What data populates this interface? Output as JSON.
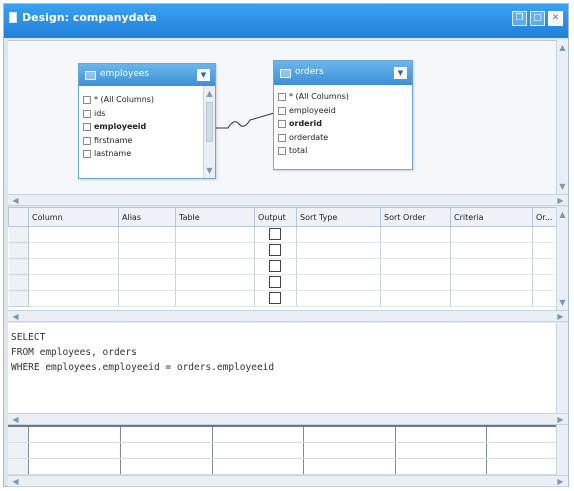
{
  "window": {
    "title": "Design: companydata",
    "icon": "document-icon",
    "buttons": [
      "restore-icon",
      "close-icon"
    ]
  },
  "diagram": {
    "tables": [
      {
        "name": "employees",
        "columns": [
          {
            "label": "* (All Columns)"
          },
          {
            "label": "ids"
          },
          {
            "label": "employeeid"
          },
          {
            "label": "firstname"
          },
          {
            "label": "lastname"
          }
        ]
      },
      {
        "name": "orders",
        "columns": [
          {
            "label": "* (All Columns)"
          },
          {
            "label": "employeeid"
          },
          {
            "label": "orderid"
          },
          {
            "label": "orderdate"
          },
          {
            "label": "total"
          }
        ]
      }
    ]
  },
  "grid": {
    "headers": [
      "Column",
      "Alias",
      "Table",
      "Output",
      "Sort Type",
      "Sort Order",
      "Criteria",
      "Or..."
    ]
  },
  "sql": {
    "lines": [
      "SELECT",
      "FROM employees, orders",
      "WHERE employees.employeeid = orders.employeeid"
    ]
  },
  "colors": {
    "titlebar": "#2a8fe3",
    "table_header": "#4a9ee0",
    "pane_background": "#f5f8fb"
  }
}
